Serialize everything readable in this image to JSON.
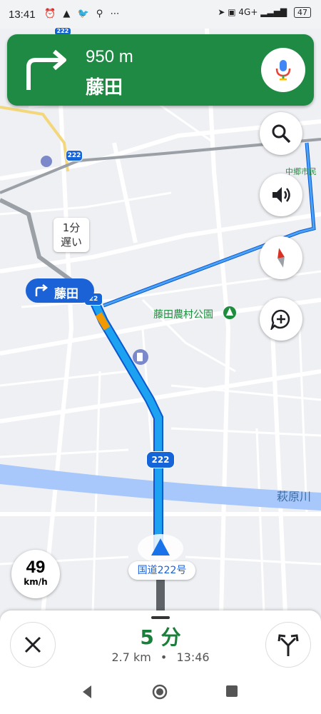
{
  "status_bar": {
    "time": "13:41",
    "left_icons": [
      "alarm-icon",
      "navigation-icon",
      "twitter-icon",
      "location-icon",
      "more-icon"
    ],
    "right_text": "4G+",
    "battery": "47"
  },
  "nav": {
    "distance": "950 m",
    "street": "藤田",
    "turn_icon": "turn-right-arrow-icon",
    "card_color": "#1f8a43"
  },
  "map": {
    "callout_text_line1": "1分",
    "callout_text_line2": "遅い",
    "turn_pill": "藤田",
    "park_label": "藤田農村公園",
    "river_label": "萩原川",
    "area_label": "中郷市民広",
    "route_shield": "222",
    "shield_small_1": "222",
    "shield_small_2": "222",
    "shield_small_3": "22",
    "current_road": "国道222号",
    "route_color": "#1a73e8"
  },
  "speed": {
    "value": "49",
    "unit": "km/h"
  },
  "bottom": {
    "eta": "5 分",
    "distance": "2.7 km",
    "separator": "•",
    "arrival": "13:46"
  }
}
